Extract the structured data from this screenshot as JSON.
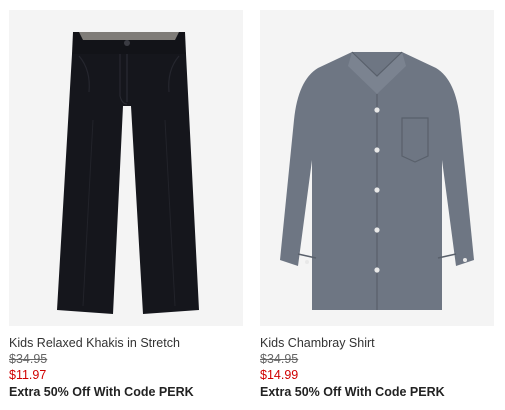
{
  "products": [
    {
      "name": "Kids Relaxed Khakis in Stretch",
      "original_price": "$34.95",
      "sale_price": "$11.97",
      "promo": "Extra 50% Off With Code PERK",
      "image_icon": "pants-icon",
      "image_color": "#15161c"
    },
    {
      "name": "Kids Chambray Shirt",
      "original_price": "$34.95",
      "sale_price": "$14.99",
      "promo": "Extra 50% Off With Code PERK",
      "image_icon": "shirt-icon",
      "image_color": "#6e7683"
    }
  ],
  "colors": {
    "sale": "#d00000",
    "image_background": "#f4f4f4"
  }
}
